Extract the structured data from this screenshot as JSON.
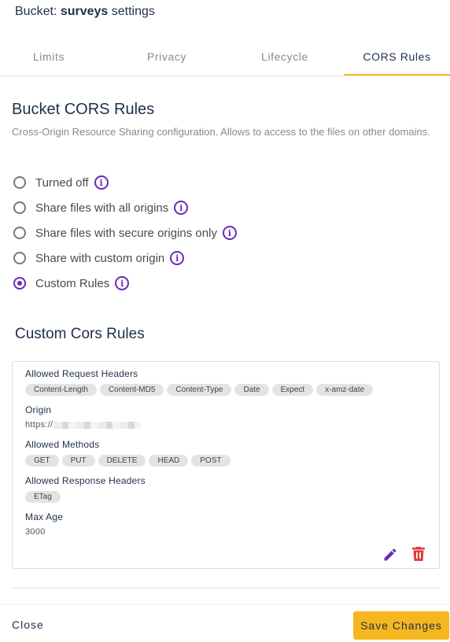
{
  "header": {
    "title_prefix": "Bucket: ",
    "bucket_name": "surveys",
    "title_suffix": " settings"
  },
  "tabs": [
    {
      "label": "Limits",
      "active": false
    },
    {
      "label": "Privacy",
      "active": false
    },
    {
      "label": "Lifecycle",
      "active": false
    },
    {
      "label": "CORS Rules",
      "active": true
    }
  ],
  "cors": {
    "heading": "Bucket CORS Rules",
    "description": "Cross-Origin Resource Sharing configuration. Allows to access to the files on other domains.",
    "options": [
      {
        "label": "Turned off",
        "checked": false
      },
      {
        "label": "Share files with all origins",
        "checked": false
      },
      {
        "label": "Share files with secure origins only",
        "checked": false
      },
      {
        "label": "Share with custom origin",
        "checked": false
      },
      {
        "label": "Custom Rules",
        "checked": true
      }
    ]
  },
  "custom_rules": {
    "heading": "Custom Cors Rules",
    "rule": {
      "allowed_request_headers_label": "Allowed Request Headers",
      "allowed_request_headers": [
        "Content-Length",
        "Content-MD5",
        "Content-Type",
        "Date",
        "Expect",
        "x-amz-date"
      ],
      "origin_label": "Origin",
      "origin_value": "https://",
      "allowed_methods_label": "Allowed Methods",
      "allowed_methods": [
        "GET",
        "PUT",
        "DELETE",
        "HEAD",
        "POST"
      ],
      "allowed_response_headers_label": "Allowed Response Headers",
      "allowed_response_headers": [
        "ETag"
      ],
      "max_age_label": "Max Age",
      "max_age_value": "3000"
    }
  },
  "footer": {
    "close_label": "Close",
    "save_label": "Save Changes"
  },
  "colors": {
    "accent": "#f5b71f",
    "primary": "#6b2ab8",
    "danger": "#e53935",
    "heading": "#1f2f4a"
  }
}
